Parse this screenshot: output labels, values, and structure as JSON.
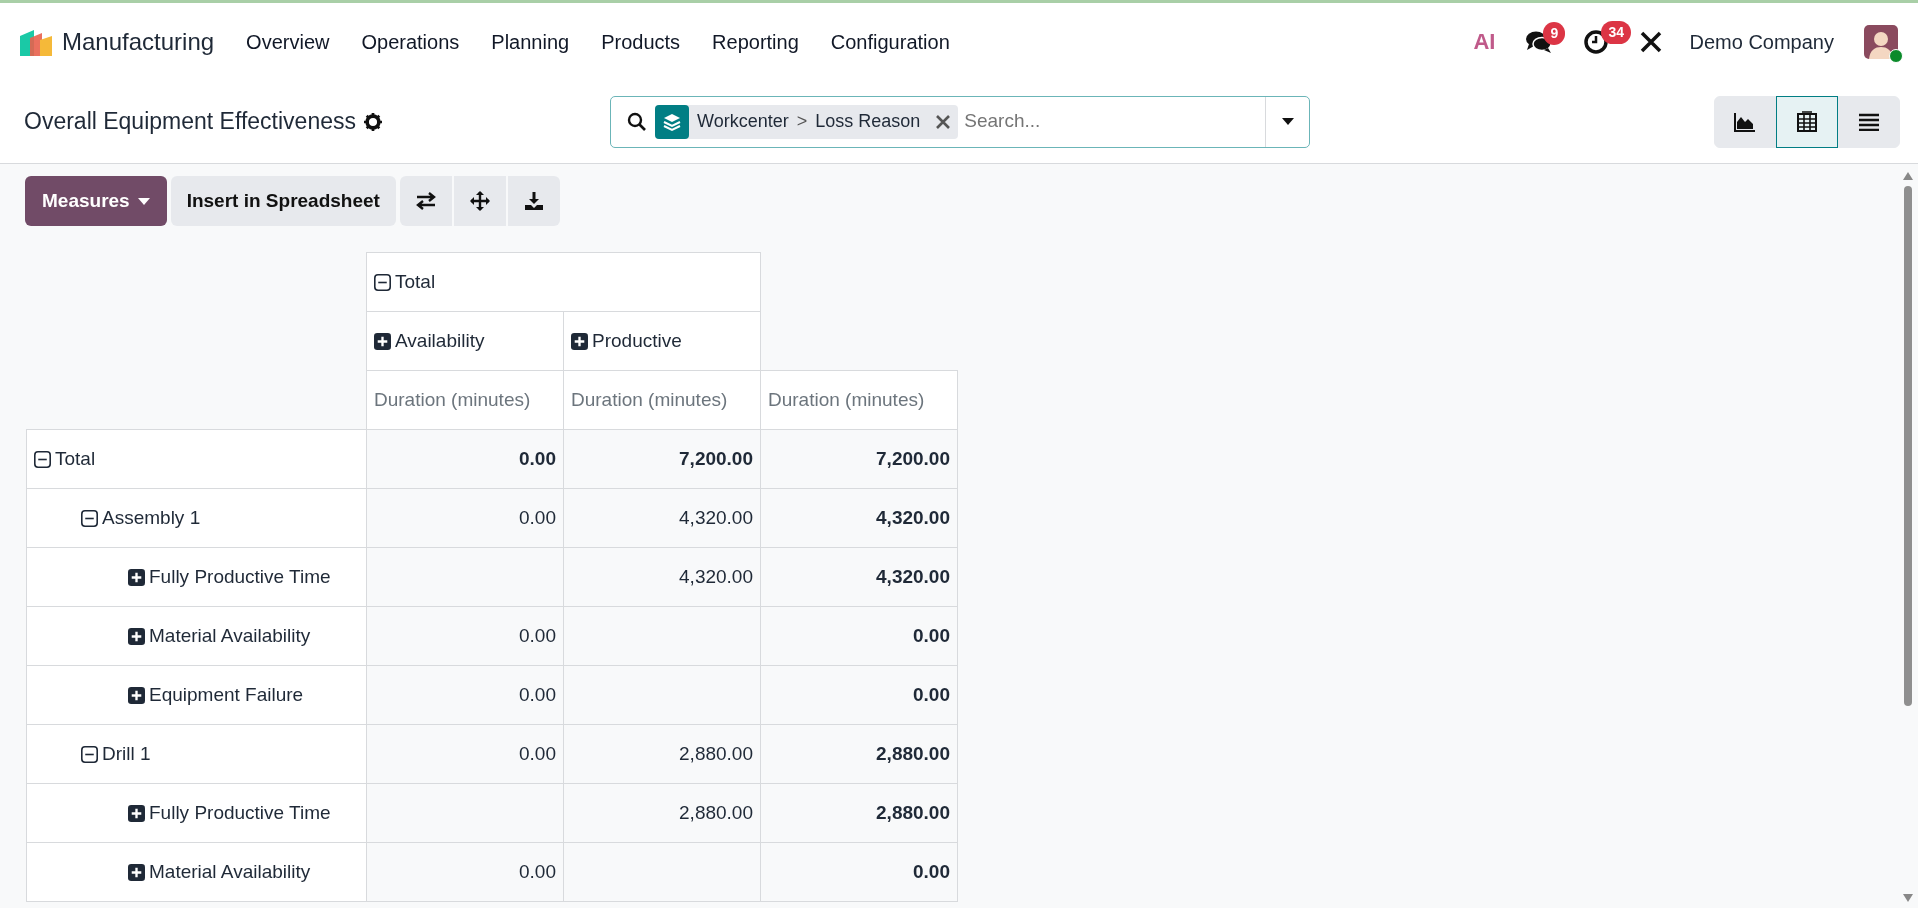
{
  "navbar": {
    "app_name": "Manufacturing",
    "menu": [
      "Overview",
      "Operations",
      "Planning",
      "Products",
      "Reporting",
      "Configuration"
    ],
    "systray": {
      "ai_label": "AI",
      "messages_count": "9",
      "activities_count": "34",
      "company": "Demo Company",
      "avatar_online": true
    }
  },
  "control_panel": {
    "title": "Overall Equipment Effectiveness",
    "search": {
      "facet_values": [
        "Workcenter",
        "Loss Reason"
      ],
      "facet_separator": ">",
      "placeholder": "Search..."
    },
    "views": [
      {
        "kind": "graph",
        "selected": false
      },
      {
        "kind": "pivot",
        "selected": true
      },
      {
        "kind": "list",
        "selected": false
      }
    ]
  },
  "toolbar": {
    "measures_label": "Measures",
    "spreadsheet_label": "Insert in Spreadsheet",
    "icon_buttons": [
      {
        "kind": "flip"
      },
      {
        "kind": "expand"
      },
      {
        "kind": "download"
      }
    ]
  },
  "pivot": {
    "column_header": {
      "label": "Total",
      "expanded": true,
      "children": [
        {
          "label": "Availability",
          "expanded": false
        },
        {
          "label": "Productive",
          "expanded": false
        }
      ]
    },
    "measures": [
      "Duration (minutes)",
      "Duration (minutes)",
      "Duration (minutes)"
    ],
    "rows": [
      {
        "label": "Total",
        "expanded": true,
        "values": {
          "availability": "0.00",
          "productive": "7,200.00",
          "total": "7,200.00"
        },
        "children": [
          {
            "label": "Assembly 1",
            "expanded": true,
            "values": {
              "availability": "0.00",
              "productive": "4,320.00",
              "total": "4,320.00"
            },
            "children": [
              {
                "label": "Fully Productive Time",
                "expanded": false,
                "values": {
                  "productive": "4,320.00",
                  "total": "4,320.00"
                }
              },
              {
                "label": "Material Availability",
                "expanded": false,
                "values": {
                  "availability": "0.00",
                  "total": "0.00"
                }
              },
              {
                "label": "Equipment Failure",
                "expanded": false,
                "values": {
                  "availability": "0.00",
                  "total": "0.00"
                }
              }
            ]
          },
          {
            "label": "Drill 1",
            "expanded": true,
            "values": {
              "availability": "0.00",
              "productive": "2,880.00",
              "total": "2,880.00"
            },
            "children": [
              {
                "label": "Fully Productive Time",
                "expanded": false,
                "values": {
                  "productive": "2,880.00",
                  "total": "2,880.00"
                }
              },
              {
                "label": "Material Availability",
                "expanded": false,
                "values": {
                  "availability": "0.00",
                  "total": "0.00"
                }
              }
            ]
          }
        ]
      }
    ]
  }
}
